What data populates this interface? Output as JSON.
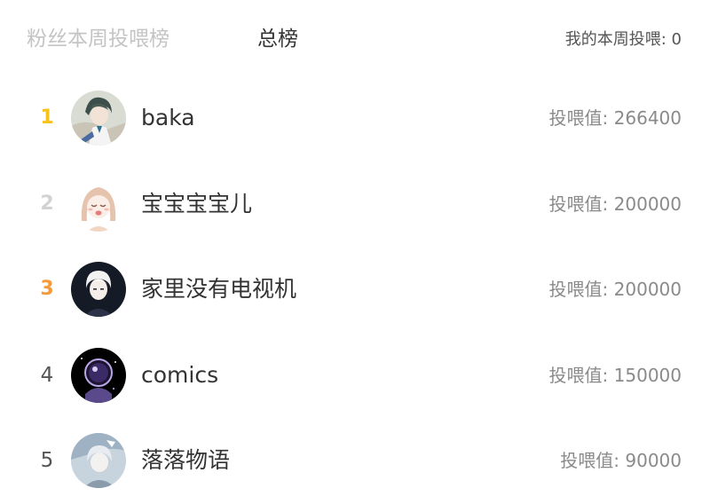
{
  "tabs": {
    "weekly": "粉丝本周投喂榜",
    "total": "总榜"
  },
  "my_votes": "我的本周投喂: 0",
  "rankings": [
    {
      "rank": "1",
      "name": "baka",
      "score": "投喂值: 266400",
      "avatar_icon": "anime-boy-avatar-icon"
    },
    {
      "rank": "2",
      "name": "宝宝宝宝儿",
      "score": "投喂值: 200000",
      "avatar_icon": "anime-girl-avatar-icon"
    },
    {
      "rank": "3",
      "name": "家里没有电视机",
      "score": "投喂值: 200000",
      "avatar_icon": "white-hair-avatar-icon"
    },
    {
      "rank": "4",
      "name": "comics",
      "score": "投喂值: 150000",
      "avatar_icon": "astronaut-avatar-icon"
    },
    {
      "rank": "5",
      "name": "落落物语",
      "score": "投喂值: 90000",
      "avatar_icon": "anime-sketch-avatar-icon"
    }
  ],
  "colors": {
    "rank_gold": "#f7c21b",
    "rank_silver": "#d2d2d2",
    "rank_bronze": "#f49a3a",
    "inactive_tab": "#c4c4c4",
    "active_tab": "#333333",
    "score_text": "#8a8a8a"
  }
}
